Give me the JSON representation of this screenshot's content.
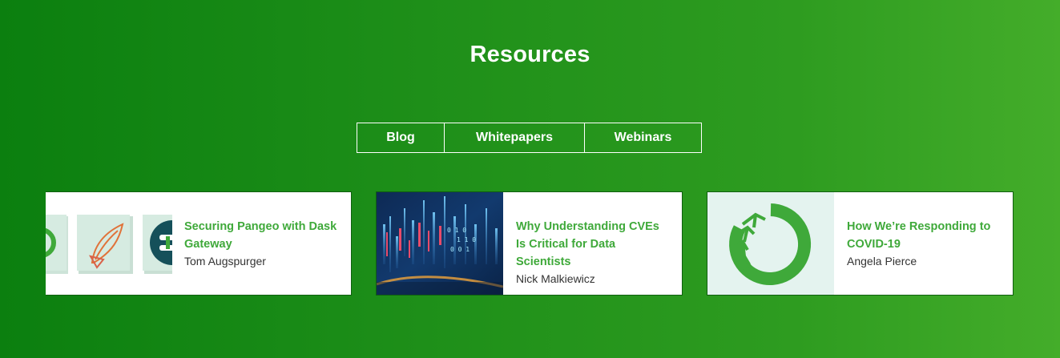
{
  "section": {
    "title": "Resources"
  },
  "tabs": [
    {
      "label": "Blog"
    },
    {
      "label": "Whitepapers"
    },
    {
      "label": "Webinars"
    }
  ],
  "cards": [
    {
      "title": "Securing Pangeo with Dask Gateway",
      "author": "Tom Augspurger",
      "thumbnail": "logo-collage-icon"
    },
    {
      "title": "Why Understanding CVEs Is Critical for Data Scientists",
      "author": "Nick Malkiewicz",
      "thumbnail": "data-visualization-image"
    },
    {
      "title": "How We’re Responding to COVID-19",
      "author": "Angela Pierce",
      "thumbnail": "anaconda-ring-logo-icon"
    }
  ],
  "colors": {
    "background_start": "#0b7f0f",
    "background_end": "#44ad2a",
    "link_green": "#3fa93a",
    "text_dark": "#333333"
  }
}
